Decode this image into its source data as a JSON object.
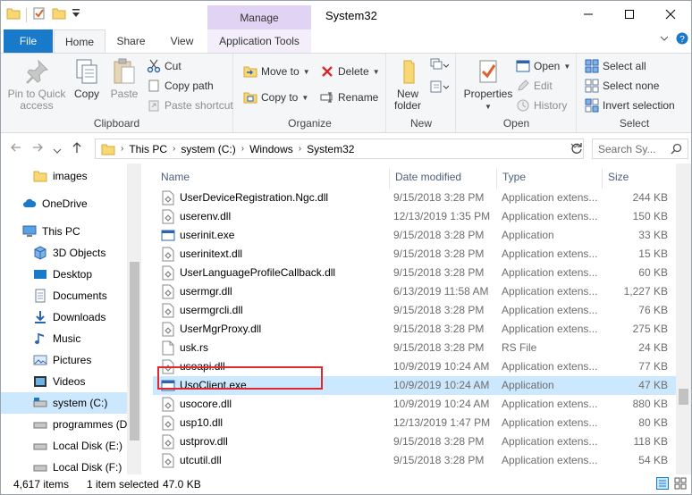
{
  "window": {
    "title": "System32",
    "manage_label": "Manage"
  },
  "tabs": {
    "file": "File",
    "home": "Home",
    "share": "Share",
    "view": "View",
    "app_tools": "Application Tools"
  },
  "ribbon": {
    "clipboard": {
      "label": "Clipboard",
      "pin": "Pin to Quick access",
      "copy": "Copy",
      "paste": "Paste",
      "cut": "Cut",
      "copy_path": "Copy path",
      "paste_shortcut": "Paste shortcut"
    },
    "organize": {
      "label": "Organize",
      "move_to": "Move to",
      "copy_to": "Copy to",
      "delete": "Delete",
      "rename": "Rename"
    },
    "new": {
      "label": "New",
      "new_folder": "New folder"
    },
    "open": {
      "label": "Open",
      "properties": "Properties",
      "open": "Open",
      "edit": "Edit",
      "history": "History"
    },
    "select": {
      "label": "Select",
      "select_all": "Select all",
      "select_none": "Select none",
      "invert": "Invert selection"
    }
  },
  "address": {
    "crumbs": [
      "This PC",
      "system (C:)",
      "Windows",
      "System32"
    ],
    "search_placeholder": "Search Sy..."
  },
  "nav": [
    {
      "label": "images",
      "icon": "folder-icon"
    },
    {
      "label": "OneDrive",
      "icon": "cloud-icon"
    },
    {
      "label": "This PC",
      "icon": "computer-icon"
    },
    {
      "label": "3D Objects",
      "icon": "cube-icon"
    },
    {
      "label": "Desktop",
      "icon": "desktop-icon"
    },
    {
      "label": "Documents",
      "icon": "documents-icon"
    },
    {
      "label": "Downloads",
      "icon": "download-icon"
    },
    {
      "label": "Music",
      "icon": "music-icon"
    },
    {
      "label": "Pictures",
      "icon": "pictures-icon"
    },
    {
      "label": "Videos",
      "icon": "videos-icon"
    },
    {
      "label": "system (C:)",
      "icon": "drive-icon"
    },
    {
      "label": "programmes (D:",
      "icon": "drive-icon"
    },
    {
      "label": "Local Disk (E:)",
      "icon": "drive-icon"
    },
    {
      "label": "Local Disk (F:)",
      "icon": "drive-icon"
    }
  ],
  "columns": {
    "name": "Name",
    "date": "Date modified",
    "type": "Type",
    "size": "Size"
  },
  "files": [
    {
      "name": "UserDeviceRegistration.Ngc.dll",
      "date": "9/15/2018 3:28 PM",
      "type": "Application extens...",
      "size": "244 KB",
      "icon": "dll-icon"
    },
    {
      "name": "userenv.dll",
      "date": "12/13/2019 1:35 PM",
      "type": "Application extens...",
      "size": "150 KB",
      "icon": "dll-icon"
    },
    {
      "name": "userinit.exe",
      "date": "9/15/2018 3:28 PM",
      "type": "Application",
      "size": "33 KB",
      "icon": "exe-icon"
    },
    {
      "name": "userinitext.dll",
      "date": "9/15/2018 3:28 PM",
      "type": "Application extens...",
      "size": "15 KB",
      "icon": "dll-icon"
    },
    {
      "name": "UserLanguageProfileCallback.dll",
      "date": "9/15/2018 3:28 PM",
      "type": "Application extens...",
      "size": "60 KB",
      "icon": "dll-icon"
    },
    {
      "name": "usermgr.dll",
      "date": "6/13/2019 11:58 AM",
      "type": "Application extens...",
      "size": "1,227 KB",
      "icon": "dll-icon"
    },
    {
      "name": "usermgrcli.dll",
      "date": "9/15/2018 3:28 PM",
      "type": "Application extens...",
      "size": "76 KB",
      "icon": "dll-icon"
    },
    {
      "name": "UserMgrProxy.dll",
      "date": "9/15/2018 3:28 PM",
      "type": "Application extens...",
      "size": "275 KB",
      "icon": "dll-icon"
    },
    {
      "name": "usk.rs",
      "date": "9/15/2018 3:28 PM",
      "type": "RS File",
      "size": "24 KB",
      "icon": "file-icon"
    },
    {
      "name": "usoapi.dll",
      "date": "10/9/2019 10:24 AM",
      "type": "Application extens...",
      "size": "77 KB",
      "icon": "dll-icon"
    },
    {
      "name": "UsoClient.exe",
      "date": "10/9/2019 10:24 AM",
      "type": "Application",
      "size": "47 KB",
      "icon": "exe-icon",
      "selected": true
    },
    {
      "name": "usocore.dll",
      "date": "10/9/2019 10:24 AM",
      "type": "Application extens...",
      "size": "880 KB",
      "icon": "dll-icon"
    },
    {
      "name": "usp10.dll",
      "date": "12/13/2019 1:47 PM",
      "type": "Application extens...",
      "size": "80 KB",
      "icon": "dll-icon"
    },
    {
      "name": "ustprov.dll",
      "date": "9/15/2018 3:28 PM",
      "type": "Application extens...",
      "size": "118 KB",
      "icon": "dll-icon"
    },
    {
      "name": "utcutil.dll",
      "date": "9/15/2018 3:28 PM",
      "type": "Application extens...",
      "size": "54 KB",
      "icon": "dll-icon"
    }
  ],
  "status": {
    "count": "4,617 items",
    "selection": "1 item selected",
    "size": "47.0 KB"
  },
  "colors": {
    "accent": "#1979ca",
    "manage": "#e1d3f3",
    "selection": "#cce8ff",
    "highlight_box": "#e0282e",
    "folder": "#f8d775"
  }
}
